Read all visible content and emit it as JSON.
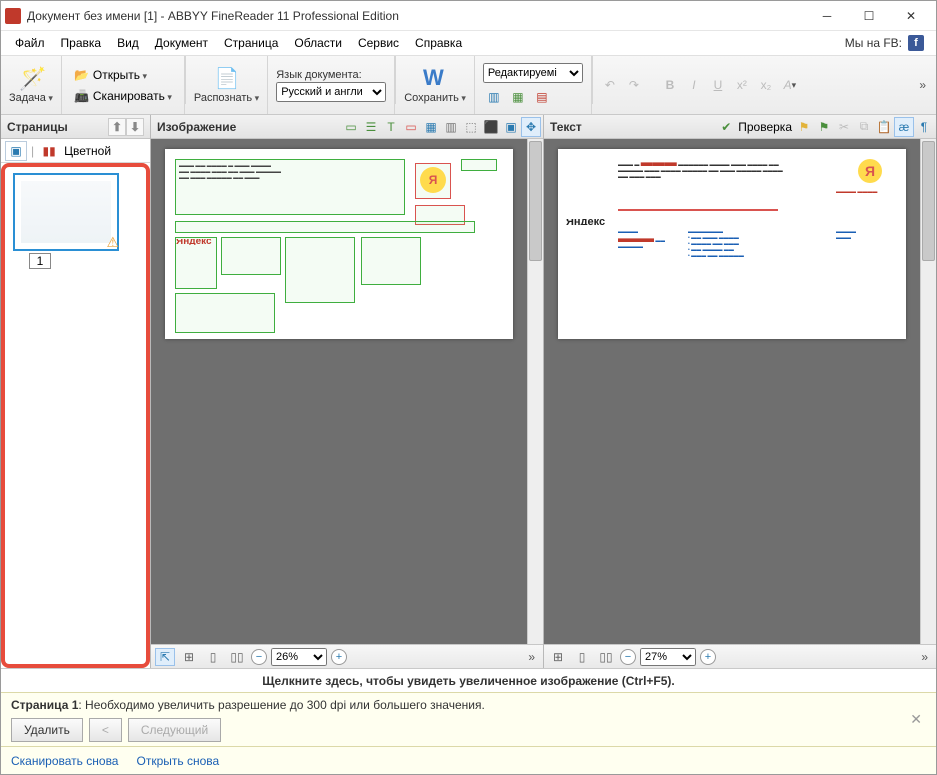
{
  "title": "Документ без имени [1] - ABBYY FineReader 11 Professional Edition",
  "menu": [
    "Файл",
    "Правка",
    "Вид",
    "Документ",
    "Страница",
    "Области",
    "Сервис",
    "Справка"
  ],
  "menu_right": "Мы на FB:",
  "toolbar": {
    "task": "Задача",
    "open": "Открыть",
    "scan": "Сканировать",
    "recognize": "Распознать",
    "lang_label": "Язык документа:",
    "lang_value": "Русский и англи",
    "save": "Сохранить",
    "edit_combo": "Редактируемі"
  },
  "pages": {
    "title": "Страницы",
    "color_mode": "Цветной",
    "thumb_num": "1"
  },
  "image_panel": {
    "title": "Изображение",
    "zoom": "26%"
  },
  "text_panel": {
    "title": "Текст",
    "verify": "Проверка",
    "zoom": "27%",
    "yandex": "Яндекс"
  },
  "hint": "Щелкните здесь, чтобы увидеть увеличенное изображение (Ctrl+F5).",
  "warn": {
    "page_label": "Страница 1",
    "msg": ": Необходимо увеличить разрешение до 300 dpi или большего значения.",
    "delete": "Удалить",
    "prev": "<",
    "next": "Следующий"
  },
  "links": {
    "scan_again": "Сканировать снова",
    "open_again": "Открыть снова"
  }
}
